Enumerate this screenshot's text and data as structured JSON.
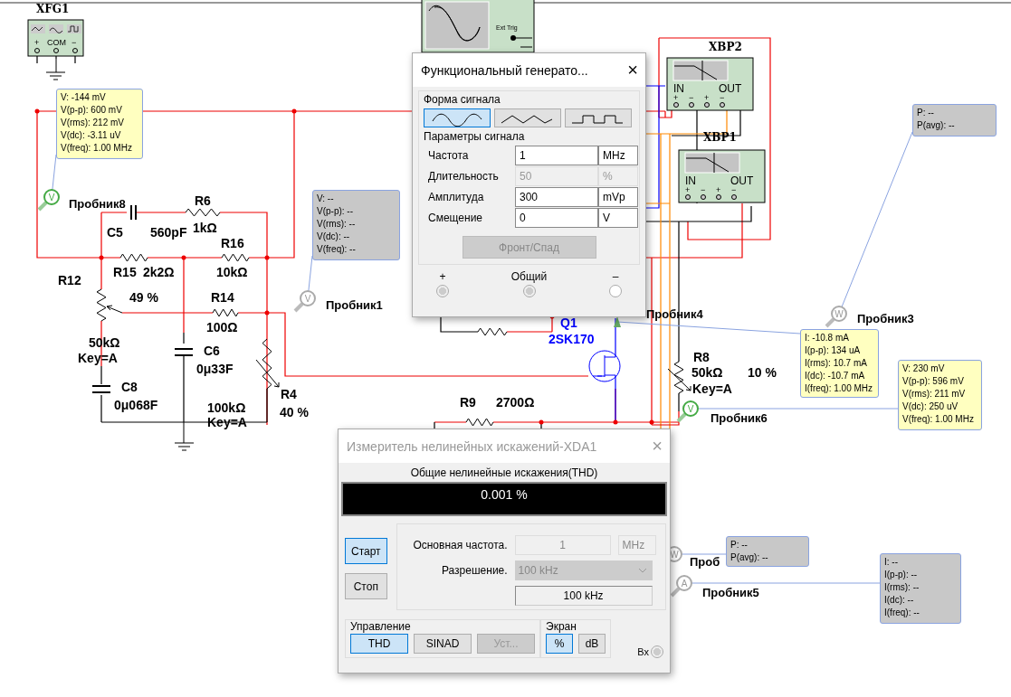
{
  "instruments": [
    {
      "kind": "generator",
      "label": "XFG1",
      "terminals": [
        "+",
        "COM",
        "−"
      ]
    },
    {
      "kind": "scope",
      "label": "Ext Trig"
    },
    {
      "kind": "bode",
      "label": "XBP2",
      "in": "IN",
      "out": "OUT",
      "terminals": [
        "+",
        "−",
        "+",
        "−"
      ]
    },
    {
      "kind": "bode",
      "label": "XBP1",
      "in": "IN",
      "out": "OUT",
      "terminals": [
        "+",
        "−",
        "+",
        "−"
      ]
    }
  ],
  "labels": [
    {
      "text": "R6",
      "kind": "ref"
    },
    {
      "text": "C5",
      "kind": "ref"
    },
    {
      "text": "560pF",
      "kind": "value"
    },
    {
      "text": "1kΩ",
      "kind": "value"
    },
    {
      "text": "R16",
      "kind": "ref"
    },
    {
      "text": "R12",
      "kind": "ref"
    },
    {
      "text": "R15",
      "kind": "ref"
    },
    {
      "text": "2k2Ω",
      "kind": "value"
    },
    {
      "text": "10kΩ",
      "kind": "value"
    },
    {
      "text": "49 %",
      "kind": "value"
    },
    {
      "text": "R14",
      "kind": "ref"
    },
    {
      "text": "100Ω",
      "kind": "value"
    },
    {
      "text": "50kΩ",
      "kind": "value"
    },
    {
      "text": "Key=A",
      "kind": "value"
    },
    {
      "text": "C6",
      "kind": "ref"
    },
    {
      "text": "0μ33F",
      "kind": "value"
    },
    {
      "text": "C8",
      "kind": "ref"
    },
    {
      "text": "0μ068F",
      "kind": "value"
    },
    {
      "text": "100kΩ",
      "kind": "value"
    },
    {
      "text": "Key=A",
      "kind": "value"
    },
    {
      "text": "R4",
      "kind": "ref"
    },
    {
      "text": "40 %",
      "kind": "value"
    },
    {
      "text": "Q1",
      "kind": "transistor"
    },
    {
      "text": "2SK170",
      "kind": "transistor"
    },
    {
      "text": "R8",
      "kind": "ref"
    },
    {
      "text": "50kΩ",
      "kind": "value"
    },
    {
      "text": "10 %",
      "kind": "value"
    },
    {
      "text": "Key=A",
      "kind": "value"
    },
    {
      "text": "R9",
      "kind": "ref"
    },
    {
      "text": "2700Ω",
      "kind": "value"
    }
  ],
  "probes": [
    {
      "name": "Пробник8",
      "kind": "V",
      "live": true,
      "readout": [
        "V: -144 mV",
        "V(p-p): 600 mV",
        "V(rms): 212 mV",
        "V(dc): -3.11 uV",
        "V(freq): 1.00 MHz"
      ]
    },
    {
      "name": "Пробник1",
      "kind": "V",
      "live": false,
      "readout": [
        "V: --",
        "V(p-p): --",
        "V(rms): --",
        "V(dc): --",
        "V(freq): --"
      ]
    },
    {
      "name": "Пробник4",
      "kind": "I",
      "live": true,
      "readout": [
        "I: -10.8 mA",
        "I(p-p): 134 uA",
        "I(rms): 10.7 mA",
        "I(dc): -10.7 mA",
        "I(freq): 1.00 MHz"
      ]
    },
    {
      "name": "Пробник3",
      "kind": "W",
      "live": false,
      "readout": [
        "P: --",
        "P(avg): --"
      ]
    },
    {
      "name": "Пробник6",
      "kind": "V",
      "live": true,
      "readout": [
        "V: 230 mV",
        "V(p-p): 596 mV",
        "V(rms): 211 mV",
        "V(dc): 250 uV",
        "V(freq): 1.00 MHz"
      ]
    },
    {
      "name": "Проб",
      "kind": "W",
      "live": false,
      "readout": [
        "P: --",
        "P(avg): --"
      ]
    },
    {
      "name": "Пробник5",
      "kind": "A",
      "live": false,
      "readout": [
        "I: --",
        "I(p-p): --",
        "I(rms): --",
        "I(dc): --",
        "I(freq): --"
      ]
    }
  ],
  "function_generator": {
    "title": "Функциональный генерато...",
    "close": "×",
    "waveform_group": "Форма сигнала",
    "waveforms": [
      {
        "kind": "sine",
        "selected": true
      },
      {
        "kind": "triangle",
        "selected": false
      },
      {
        "kind": "square",
        "selected": false
      }
    ],
    "params_group": "Параметры сигнала",
    "params": [
      {
        "label": "Частота",
        "value": "1",
        "unit": "MHz",
        "disabled": false
      },
      {
        "label": "Длительность",
        "value": "50",
        "unit": "%",
        "disabled": true
      },
      {
        "label": "Амплитуда",
        "value": "300",
        "unit": "mVp",
        "disabled": false
      },
      {
        "label": "Смещение",
        "value": "0",
        "unit": "V",
        "disabled": false
      }
    ],
    "edge_button": {
      "label": "Фронт/Спад",
      "disabled": true
    },
    "terminals": [
      {
        "label": "+",
        "connected": true
      },
      {
        "label": "Общий",
        "connected": true
      },
      {
        "label": "–",
        "connected": false
      }
    ]
  },
  "distortion_analyzer": {
    "title": "Измеритель нелинейных искажений-XDA1",
    "close": "×",
    "caption": "Общие нелинейные искажения(THD)",
    "reading": "0.001 %",
    "run_buttons": [
      {
        "label": "Старт",
        "selected": true
      },
      {
        "label": "Стоп",
        "selected": false
      }
    ],
    "fundamental": {
      "label": "Основная частота.",
      "value": "1",
      "unit": "MHz"
    },
    "resolution": {
      "label": "Разрешение.",
      "value": "100 kHz",
      "readout": "100 kHz"
    },
    "control_group": "Управление",
    "controls": [
      {
        "label": "THD",
        "selected": true,
        "disabled": false
      },
      {
        "label": "SINAD",
        "selected": false,
        "disabled": false
      },
      {
        "label": "Уст...",
        "selected": false,
        "disabled": true
      }
    ],
    "display_group": "Экран",
    "display": [
      {
        "label": "%",
        "selected": true
      },
      {
        "label": "dB",
        "selected": false
      }
    ],
    "input": {
      "label": "Вх",
      "connected": true
    }
  }
}
